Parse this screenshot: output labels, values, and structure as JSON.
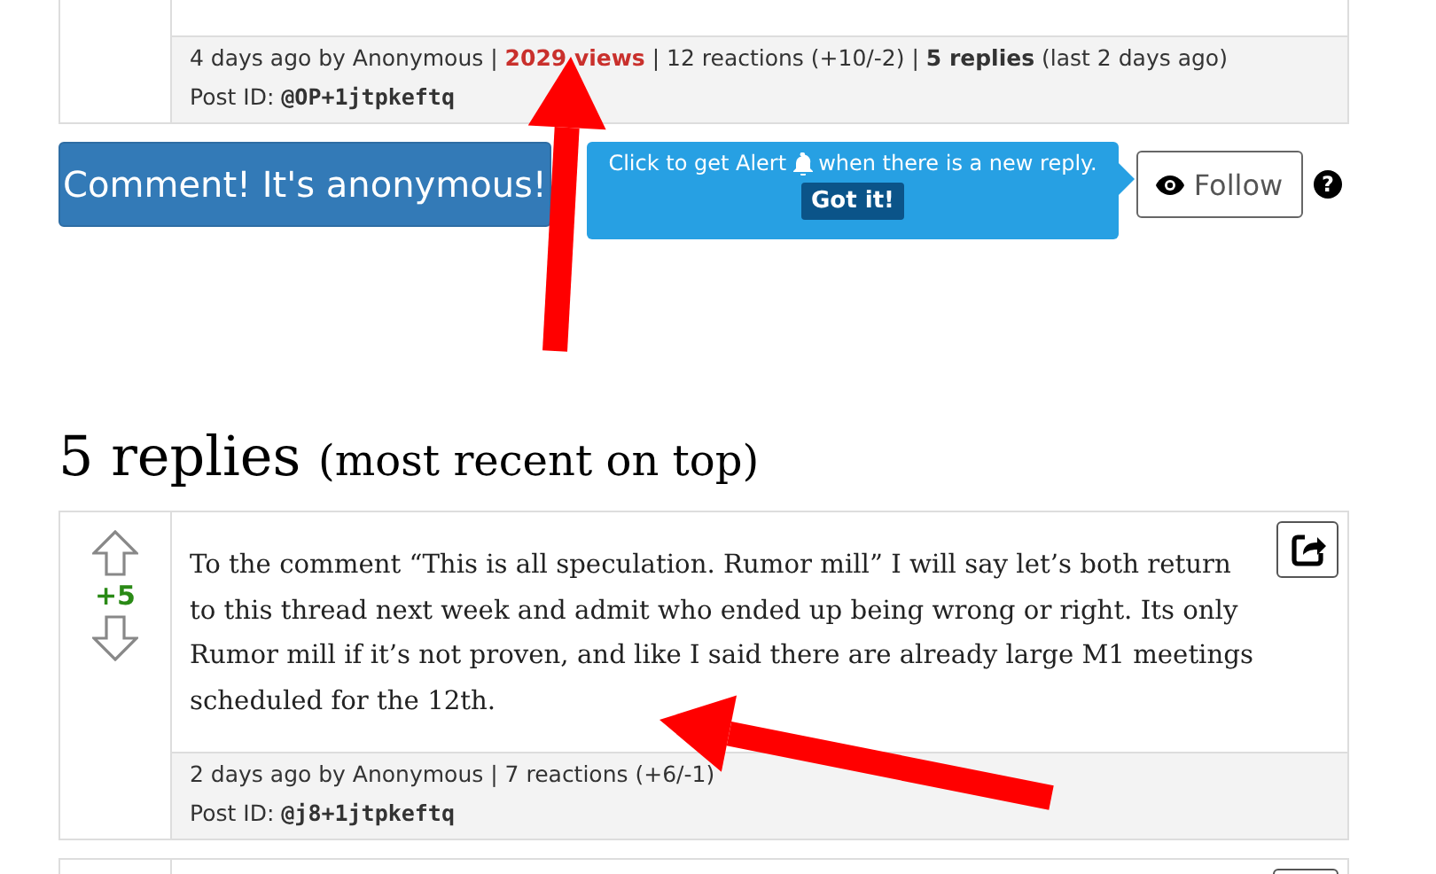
{
  "previous_post": {
    "meta": [
      {
        "text": "4 days ago by Anonymous",
        "kind": "plain"
      },
      {
        "text": "2029 views",
        "kind": "views"
      },
      {
        "text": "12 reactions (+10/-2)",
        "kind": "plain"
      },
      {
        "text": "5 replies",
        "kind": "bold",
        "note": "(last 2 days ago)"
      }
    ],
    "separator": "|",
    "post_id_label": "Post ID:",
    "post_id": "@OP+1jtpkeftq"
  },
  "actions": {
    "comment_button": "Comment! It's anonymous!",
    "tooltip": {
      "text": "Click to get Alert",
      "text_after": "when there is a new reply.",
      "button": "Got it!"
    },
    "follow_button": "Follow",
    "help": "?"
  },
  "replies_heading": {
    "count": "5 replies",
    "note": "(most recent on top)"
  },
  "replies": [
    {
      "score": "+5",
      "text": "To the comment “This is all speculation. Rumor mill” I will say let’s both return to this thread next week and admit who ended up being wrong or right. Its only Rumor mill if it’s not proven, and like I said there are already large M1 meetings scheduled for the 12th.",
      "meta": [
        {
          "text": "2 days ago by Anonymous",
          "kind": "plain"
        },
        {
          "text": "7 reactions (+6/-1)",
          "kind": "plain"
        }
      ],
      "separator": "|",
      "post_id_label": "Post ID:",
      "post_id": "@j8+1jtpkeftq"
    }
  ]
}
